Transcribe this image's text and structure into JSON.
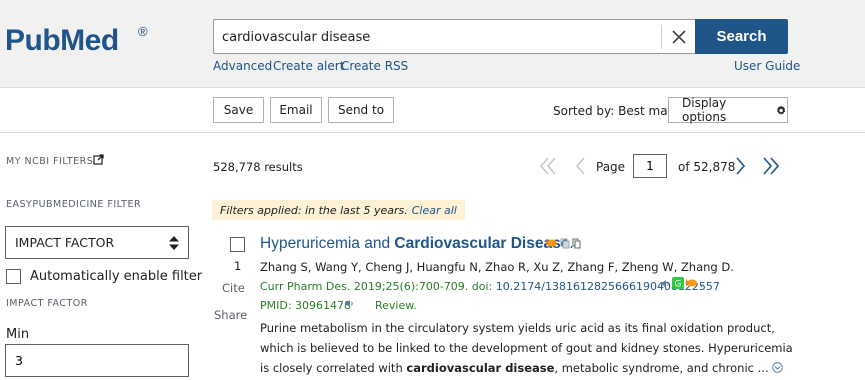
{
  "header": {
    "logo_text": "PubMed",
    "logo_reg": "®",
    "search_value": "cardiovascular disease",
    "search_button": "Search",
    "links": {
      "advanced": "Advanced",
      "create_alert": "Create alert",
      "create_rss": "Create RSS",
      "user_guide": "User Guide"
    }
  },
  "toolbar": {
    "save": "Save",
    "email": "Email",
    "send_to": "Send to",
    "sorted_by": "Sorted by: Best match",
    "display_options": "Display options"
  },
  "sidebar": {
    "my_ncbi_filters": "MY NCBI FILTERS",
    "easy_filter": "EASYPUBMEDICINE FILTER",
    "select_value": "IMPACT FACTOR",
    "auto_enable": "Automatically enable filter",
    "impact_factor_label": "IMPACT FACTOR",
    "min_label": "Min",
    "min_value": "3"
  },
  "results": {
    "count": "528,778 results",
    "page_label": "Page",
    "page_value": "1",
    "page_of": "of 52,878",
    "filters_applied": "Filters applied: in the last 5 years.",
    "clear_all": "Clear all"
  },
  "article": {
    "number": "1",
    "cite": "Cite",
    "share": "Share",
    "title_plain": "Hyperuricemia and ",
    "title_bold": "Cardiovascular Disease",
    "title_end": ".",
    "authors": "Zhang S, Wang Y, Cheng J, Huangfu N, Zhao R, Xu Z, Zhang F, Zheng W, Zhang D.",
    "journal": "Curr Pharm Des. 2019;25(6):700-709. doi: ",
    "doi": "10.2174/1381612825666190408122557",
    "pmid": "PMID: 30961478",
    "type": "Review.",
    "snippet_1": "Purine metabolism in the circulatory system yields uric acid as its final oxidation product, which is believed to be linked to the development of gout and kidney stones. Hyperuricemia is closely correlated with ",
    "snippet_bold": "cardiovascular disease",
    "snippet_2": ", metabolic syndrome, and chronic ..."
  },
  "colors": {
    "brand": "#20558a",
    "citation_green": "#2a7d2a",
    "filter_bg": "#fdf2d6",
    "header_bg": "#f1f1f1"
  },
  "icons": [
    "clear-icon",
    "external-link-icon",
    "gear-icon",
    "sort-arrows-icon",
    "first-page-icon",
    "prev-page-icon",
    "next-page-icon",
    "last-page-icon",
    "expand-icon"
  ]
}
